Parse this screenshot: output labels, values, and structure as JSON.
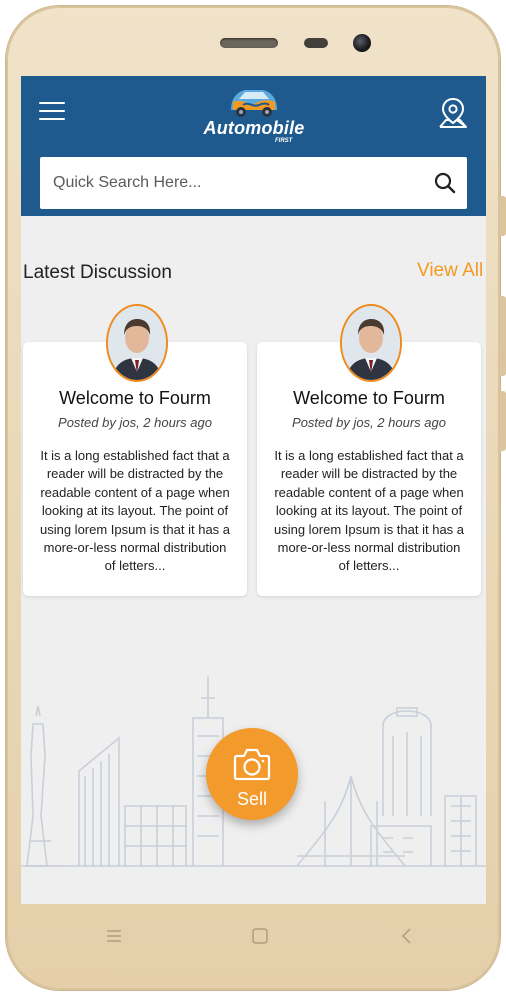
{
  "app": {
    "brand_name": "Automobile",
    "brand_sub": "FIRST"
  },
  "search": {
    "placeholder": "Quick Search Here...",
    "value": ""
  },
  "section": {
    "title": "Latest Discussion",
    "view_all": "View All"
  },
  "discussions": [
    {
      "title": "Welcome to Fourm",
      "meta": "Posted by jos, 2 hours ago",
      "body": "It is a long established fact that a reader will be distracted by the readable content of a page when looking at its layout. The point of using lorem Ipsum is that it has a more-or-less normal distribution of letters..."
    },
    {
      "title": "Welcome to Fourm",
      "meta": "Posted by jos, 2 hours ago",
      "body": "It is a long established fact that a reader will be distracted by the readable content of a page when looking at its layout. The point of using lorem Ipsum is that it has a more-or-less normal distribution of letters..."
    }
  ],
  "fab": {
    "label": "Sell",
    "icon": "camera-icon"
  },
  "icons": {
    "menu": "hamburger-menu-icon",
    "location": "location-pin-icon",
    "search": "search-icon",
    "nav_menu": "nav-menu-icon",
    "nav_home": "nav-home-icon",
    "nav_back": "nav-back-icon"
  },
  "colors": {
    "header": "#1f5a8e",
    "accent": "#f39a22",
    "background": "#efefef",
    "phone_frame": "#ead9b9"
  }
}
